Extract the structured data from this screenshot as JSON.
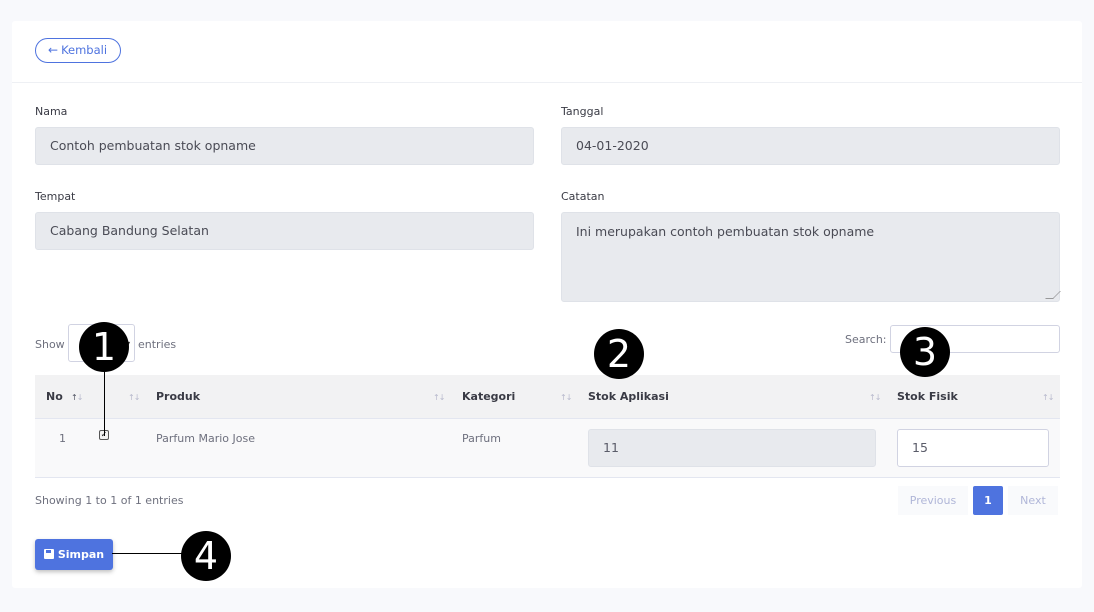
{
  "header": {
    "back_label": "Kembali"
  },
  "form": {
    "nama_label": "Nama",
    "nama_value": "Contoh pembuatan stok opname",
    "tanggal_label": "Tanggal",
    "tanggal_value": "04-01-2020",
    "tempat_label": "Tempat",
    "tempat_value": "Cabang Bandung Selatan",
    "catatan_label": "Catatan",
    "catatan_value": "Ini merupakan contoh pembuatan stok opname"
  },
  "table_controls": {
    "show_label": "Show",
    "entries_label": "entries",
    "search_label": "Search:"
  },
  "table": {
    "columns": [
      "No",
      "Produk",
      "Kategori",
      "Stok Aplikasi",
      "Stok Fisik"
    ],
    "rows": [
      {
        "no": "1",
        "checked": true,
        "produk": "Parfum Mario Jose",
        "kategori": "Parfum",
        "stok_aplikasi": "11",
        "stok_fisik": "15"
      }
    ]
  },
  "footer": {
    "info": "Showing 1 to 1 of 1 entries",
    "previous": "Previous",
    "page": "1",
    "next": "Next",
    "save_label": "Simpan"
  },
  "markers": [
    "1",
    "2",
    "3",
    "4"
  ],
  "colors": {
    "primary": "#4e73df",
    "field_bg": "#e8eaee",
    "marker": "#000000"
  }
}
